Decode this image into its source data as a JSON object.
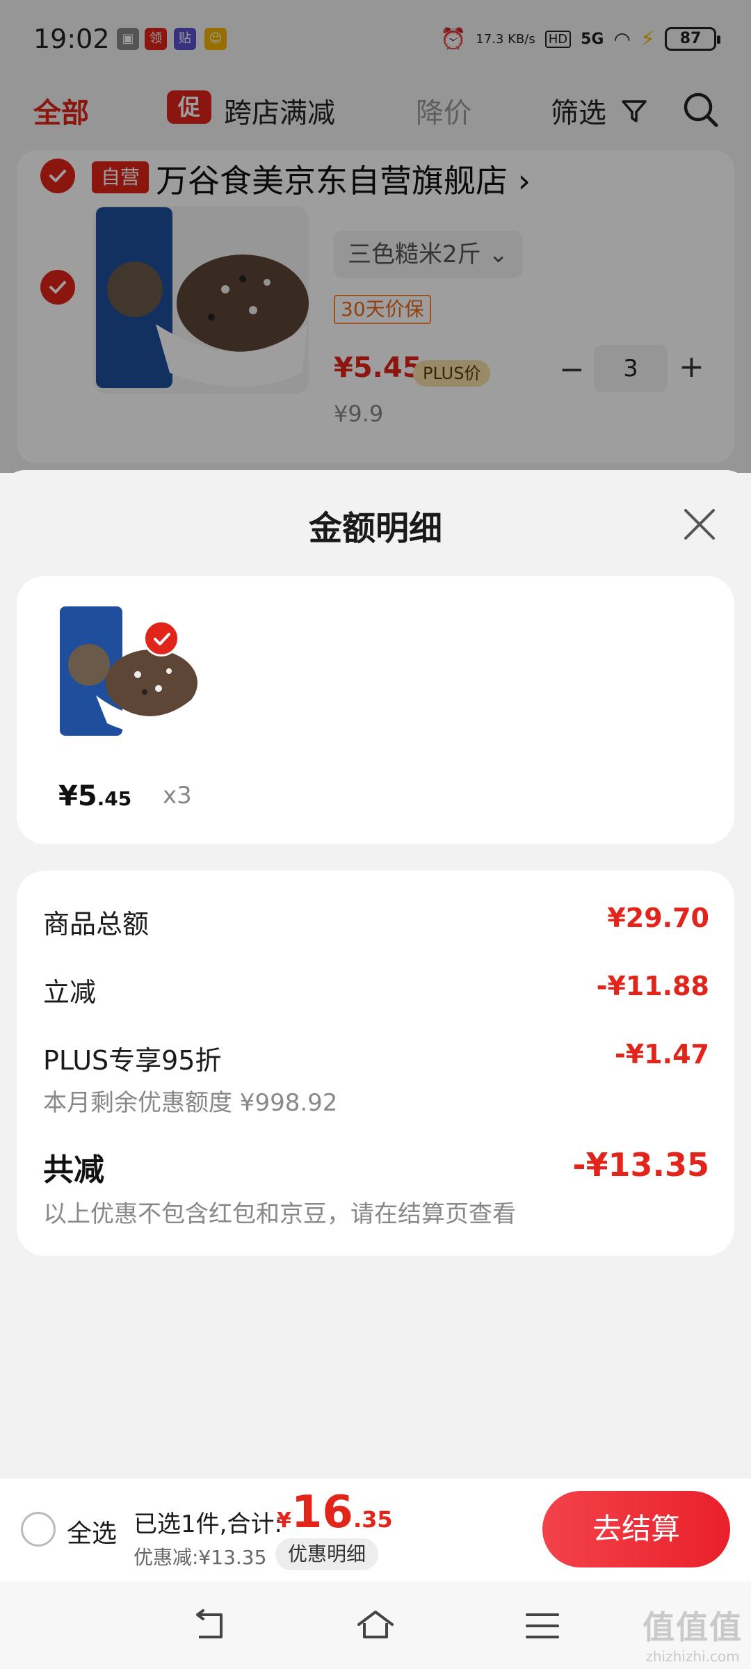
{
  "status_bar": {
    "time": "19:02",
    "apps": [
      "领",
      "贴"
    ],
    "network_speed": "17.3 KB/s",
    "hd": "HD",
    "signal": "5G",
    "battery": "87"
  },
  "top_nav": {
    "tab_all": "全部",
    "promo_badge": "促",
    "tab_cross_store": "跨店满减",
    "tab_price_drop": "降价",
    "tab_filter": "筛选"
  },
  "store": {
    "tag": "自营",
    "name": "万谷食美京东自营旗舰店 ›",
    "product": {
      "variant": "三色糙米2斤",
      "guarantee": "30天价保",
      "price": "¥5.45",
      "plus_tag": "PLUS价",
      "original_price": "¥9.9",
      "quantity": "3"
    }
  },
  "sheet": {
    "title": "金额明细",
    "item": {
      "price_int": "¥5",
      "price_dec": ".45",
      "qty": "x3"
    },
    "rows": {
      "goods_total_label": "商品总额",
      "goods_total_value": "¥29.70",
      "instant_off_label": "立减",
      "instant_off_value": "-¥11.88",
      "plus_label": "PLUS专享95折",
      "plus_value": "-¥1.47",
      "plus_sub": "本月剩余优惠额度 ¥998.92",
      "total_off_label": "共减",
      "total_off_value": "-¥13.35",
      "note": "以上优惠不包含红包和京豆，请在结算页查看"
    }
  },
  "bottom_bar": {
    "select_all": "全选",
    "selected_summary": "已选1件,合计:",
    "total_currency": "¥",
    "total_int": "16",
    "total_dec": ".35",
    "discount_text": "优惠减:¥13.35",
    "discount_detail": "优惠明细",
    "checkout": "去结算"
  },
  "watermark": {
    "big": "值值值",
    "small": "zhizhizhi.com"
  },
  "colors": {
    "accent_red": "#e1251b",
    "sheet_bg": "#f2f2f2",
    "card_bg": "#ffffff"
  }
}
